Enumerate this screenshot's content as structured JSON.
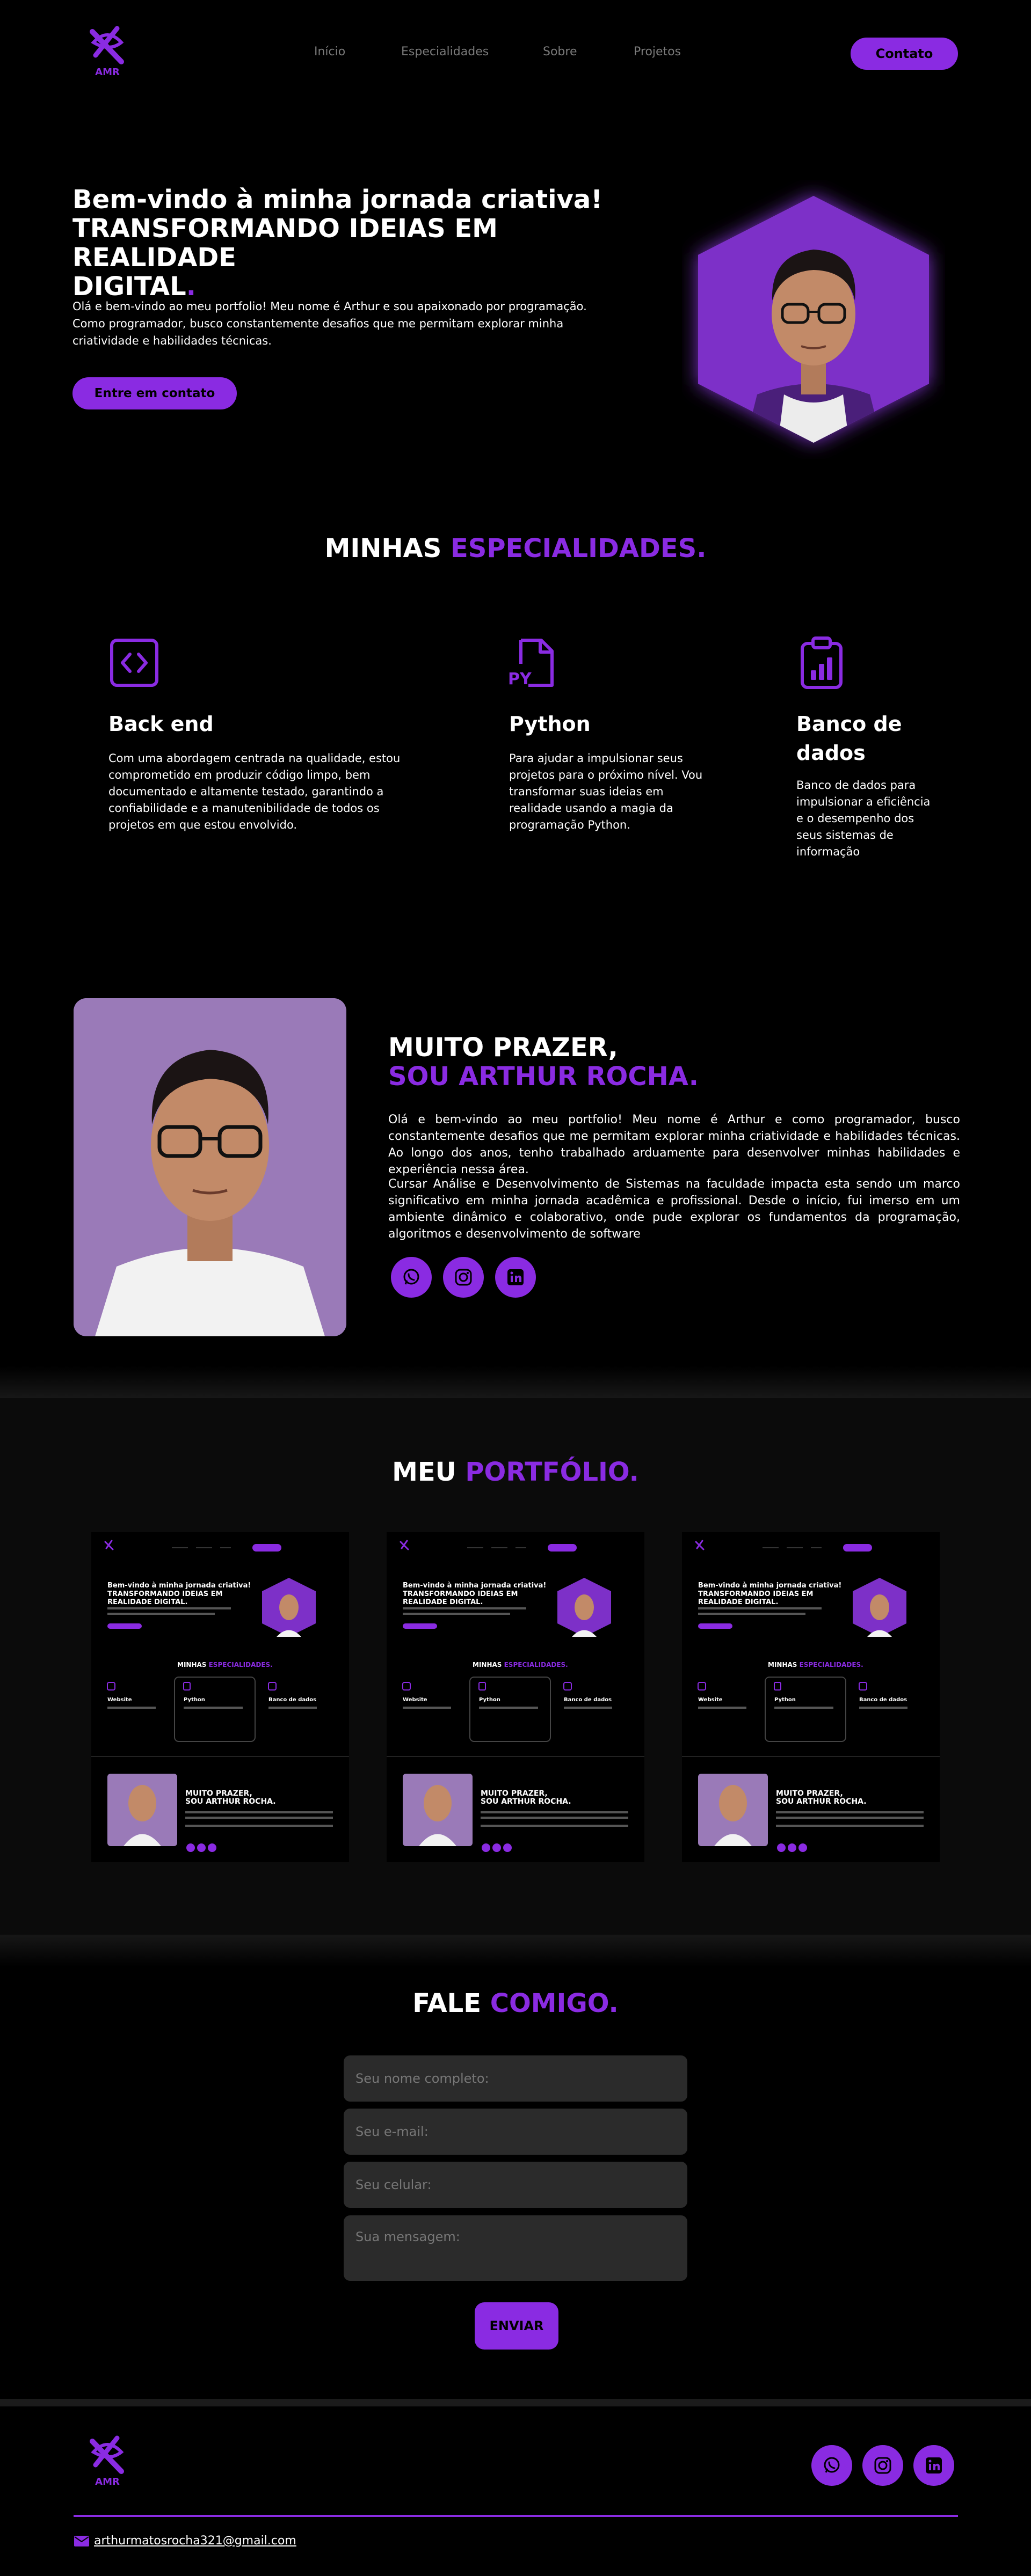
{
  "header": {
    "logo_text": "AMR",
    "nav": [
      "Início",
      "Especialidades",
      "Sobre",
      "Projetos"
    ],
    "contact_button": "Contato"
  },
  "hero": {
    "line1": "Bem-vindo à minha jornada criativa!",
    "line2": "TRANSFORMANDO IDEIAS EM REALIDADE",
    "line3": "DIGITAL",
    "dot": ".",
    "paragraph": "Olá e bem-vindo ao meu portfolio! Meu nome é Arthur e sou apaixonado por programação. Como programador, busco constantemente desafios que me permitam explorar minha criatividade e habilidades técnicas.",
    "cta": "Entre em contato"
  },
  "specialties": {
    "title_white": "MINHAS ",
    "title_purple": "ESPECIALIDADES.",
    "items": [
      {
        "icon": "code-icon",
        "title": "Back end",
        "text": "Com uma abordagem centrada na qualidade, estou comprometido em produzir código limpo, bem documentado e altamente testado, garantindo a confiabilidade e a manutenibilidade de todos os projetos em que estou envolvido."
      },
      {
        "icon": "python-file-icon",
        "title": "Python",
        "text": "Para ajudar a impulsionar seus projetos para o próximo nível. Vou transformar suas ideias em realidade usando a magia da programação Python."
      },
      {
        "icon": "clipboard-chart-icon",
        "title": "Banco de dados",
        "text": "Banco de dados para impulsionar a eficiência e o desempenho dos seus sistemas de informação"
      }
    ]
  },
  "about": {
    "title_white": "MUITO PRAZER,",
    "title_purple": "SOU ARTHUR ROCHA.",
    "p1": "Olá e bem-vindo ao meu portfolio! Meu nome é Arthur e como programador, busco constantemente desafios que me permitam explorar minha criatividade e habilidades técnicas. Ao longo dos anos, tenho trabalhado arduamente para desenvolver minhas habilidades e experiência nessa área.",
    "p2": "Cursar Análise e Desenvolvimento de Sistemas na faculdade impacta esta sendo um marco significativo em minha jornada acadêmica e profissional. Desde o início, fui imerso em um ambiente dinâmico e colaborativo, onde pude explorar os fundamentos da programação, algoritmos e desenvolvimento de software",
    "social": [
      "whatsapp-icon",
      "instagram-icon",
      "linkedin-icon"
    ]
  },
  "portfolio": {
    "title_white": "MEU ",
    "title_purple": "PORTFÓLIO.",
    "thumb": {
      "hero_line1": "Bem-vindo à minha jornada criativa!",
      "hero_line2": "TRANSFORMANDO IDEIAS EM REALIDADE DIGITAL.",
      "spec_white": "MINHAS ",
      "spec_purple": "ESPECIALIDADES.",
      "cards": [
        "Website",
        "Python",
        "Banco de dados"
      ],
      "about_white": "MUITO PRAZER,",
      "about_purple": "SOU ARTHUR ROCHA."
    }
  },
  "contact": {
    "title_white": "FALE ",
    "title_purple": "COMIGO.",
    "name_placeholder": "Seu nome completo:",
    "email_placeholder": "Seu e-mail:",
    "phone_placeholder": "Seu celular:",
    "message_placeholder": "Sua mensagem:",
    "send": "ENVIAR"
  },
  "footer": {
    "logo_text": "AMR",
    "email": "arthurmatosrocha321@gmail.com",
    "social": [
      "whatsapp-icon",
      "instagram-icon",
      "linkedin-icon"
    ]
  },
  "colors": {
    "accent": "#8a2be2",
    "background": "#000000",
    "field": "#2b2b2b",
    "band": "#0d0d0d"
  }
}
